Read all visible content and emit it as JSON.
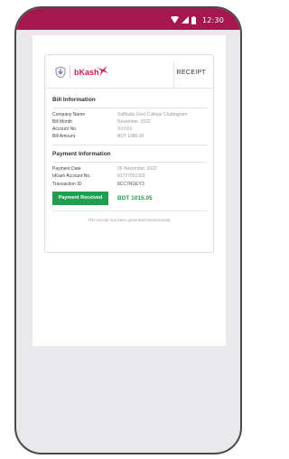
{
  "status_bar": {
    "time": "12:30",
    "icons": [
      "wifi-icon",
      "signal-icon",
      "battery-icon"
    ]
  },
  "receipt": {
    "brand": "bKash",
    "label": "RECEIPT",
    "bill_section": {
      "title": "Bill Information",
      "rows": [
        {
          "label": "Company Name",
          "value": "Saffiadia Govt College Chattogram"
        },
        {
          "label": "Bill Month",
          "value": "November, 2022"
        },
        {
          "label": "Account No.",
          "value": "XXXXX"
        },
        {
          "label": "Bill Amount",
          "value": "BDT 1080.00"
        }
      ]
    },
    "payment_section": {
      "title": "Payment Information",
      "rows": [
        {
          "label": "Payment Date",
          "value": "05 November, 2022"
        },
        {
          "label": "bKash Account No.",
          "value": "01727001303"
        },
        {
          "label": "Transaction ID",
          "value": "8CC7RGEY3"
        }
      ]
    },
    "status": "Payment Received",
    "amount": "BDT 1015.05",
    "footer": "This receipt has been generated electronically"
  },
  "colors": {
    "brand_primary": "#a5184f",
    "bkash_pink": "#d12053",
    "success_green": "#1f9f4f"
  }
}
